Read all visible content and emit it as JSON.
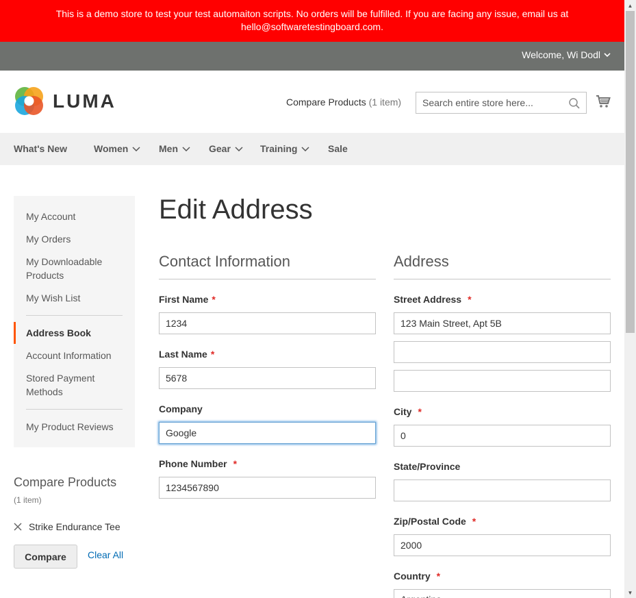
{
  "banner": {
    "line1": "This is a demo store to test your test automaiton scripts. No orders will be fulfilled. If you are facing any issue, email us at",
    "line2": "hello@softwaretestingboard.com."
  },
  "welcome": {
    "text": "Welcome, Wi Dodl"
  },
  "header": {
    "logo_text": "LUMA",
    "compare_label": "Compare Products",
    "compare_count": "(1 item)",
    "search_placeholder": "Search entire store here...",
    "search_value": ""
  },
  "nav": [
    {
      "label": "What's New",
      "has_dropdown": false
    },
    {
      "label": "Women",
      "has_dropdown": true
    },
    {
      "label": "Men",
      "has_dropdown": true
    },
    {
      "label": "Gear",
      "has_dropdown": true
    },
    {
      "label": "Training",
      "has_dropdown": true
    },
    {
      "label": "Sale",
      "has_dropdown": false
    }
  ],
  "sidebar": {
    "items": [
      {
        "label": "My Account"
      },
      {
        "label": "My Orders"
      },
      {
        "label": "My Downloadable Products"
      },
      {
        "label": "My Wish List"
      },
      {
        "label": "Address Book",
        "active": true
      },
      {
        "label": "Account Information"
      },
      {
        "label": "Stored Payment Methods"
      },
      {
        "label": "My Product Reviews"
      }
    ]
  },
  "compare_block": {
    "title": "Compare Products",
    "count": "(1 item)",
    "product": "Strike Endurance Tee",
    "compare_button": "Compare",
    "clear_all": "Clear All"
  },
  "page": {
    "title": "Edit Address"
  },
  "contact": {
    "title": "Contact Information",
    "first_name_label": "First Name",
    "first_name_value": "1234",
    "last_name_label": "Last Name",
    "last_name_value": "5678",
    "company_label": "Company",
    "company_value": "Google",
    "phone_label": "Phone Number",
    "phone_value": "1234567890"
  },
  "address": {
    "title": "Address",
    "street_label": "Street Address",
    "street_1": "123 Main Street, Apt 5B",
    "street_2": "",
    "street_3": "",
    "city_label": "City",
    "city_value": "0",
    "state_label": "State/Province",
    "state_value": "",
    "zip_label": "Zip/Postal Code",
    "zip_value": "2000",
    "country_label": "Country",
    "country_value": "Argentina"
  },
  "required_marker": "*",
  "colors": {
    "banner_bg": "#ff0000",
    "welcome_bg": "#6e716e",
    "nav_bg": "#f0f0f0",
    "sidebar_bg": "#f5f5f5",
    "active_accent": "#ff5501",
    "link": "#006bb4",
    "required": "#e02b27"
  }
}
